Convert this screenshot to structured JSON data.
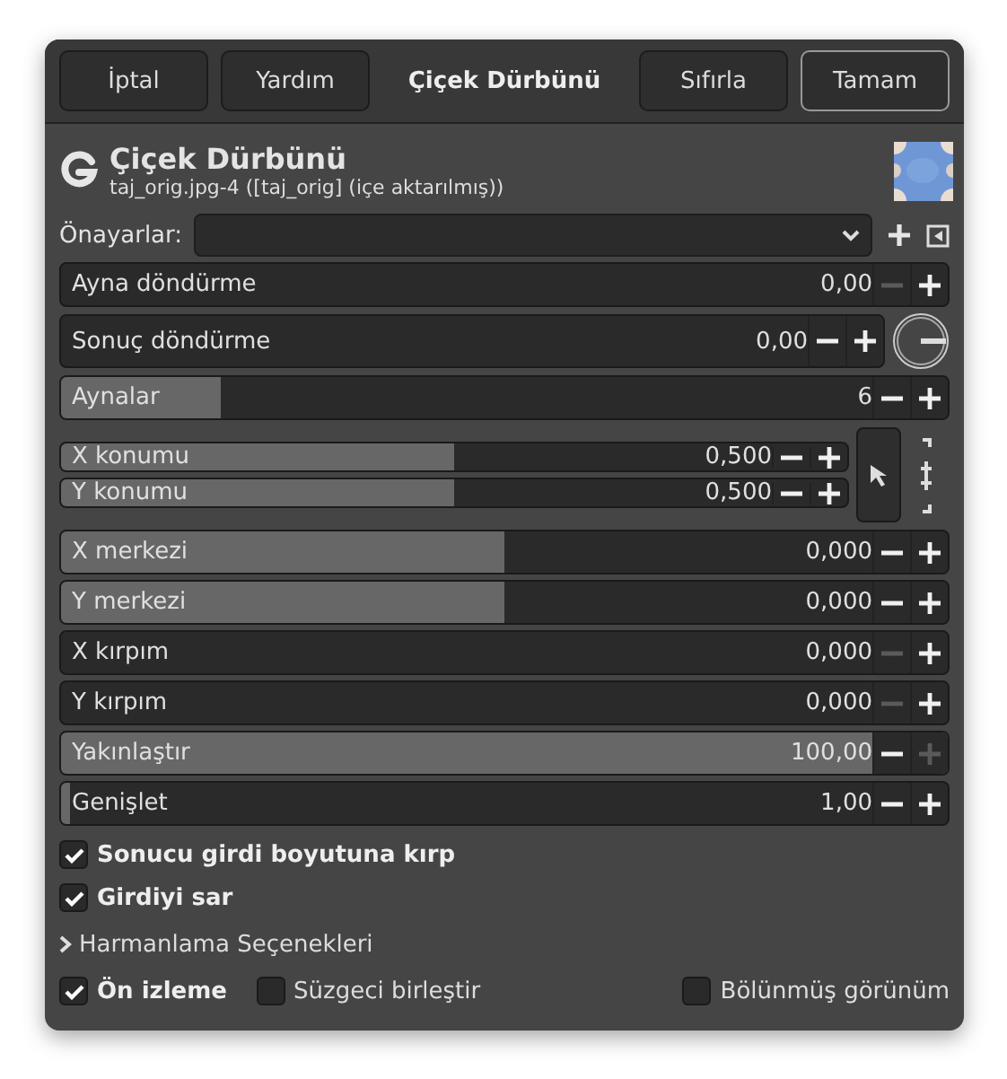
{
  "buttons": [
    {
      "label": "İptal",
      "default": false
    },
    {
      "label": "Yardım",
      "default": false
    }
  ],
  "dialog_title": "Çiçek Dürbünü",
  "buttons_right": [
    {
      "label": "Sıfırla",
      "default": false
    },
    {
      "label": "Tamam",
      "default": true
    }
  ],
  "header": {
    "title": "Çiçek Dürbünü",
    "subtitle": "taj_orig.jpg-4 ([taj_orig] (içe aktarılmış))"
  },
  "presets": {
    "label": "Önayarlar:"
  },
  "rows": [
    {
      "kind": "slider",
      "name": "Ayna döndürme",
      "value": "0,00",
      "level": 0,
      "minus_disabled": true,
      "plus_disabled": false
    },
    {
      "kind": "dial",
      "name": "Sonuç döndürme",
      "value": "0,00",
      "level": 0,
      "minus_disabled": false,
      "plus_disabled": false
    },
    {
      "kind": "slider",
      "name": "Aynalar",
      "value": "6",
      "level": 0.18,
      "minus_disabled": false,
      "plus_disabled": false
    },
    {
      "kind": "pair",
      "sliders": [
        {
          "name": "X konumu",
          "value": "0,500",
          "level": 0.5,
          "minus_disabled": false,
          "plus_disabled": false
        },
        {
          "name": "Y konumu",
          "value": "0,500",
          "level": 0.5,
          "minus_disabled": false,
          "plus_disabled": false
        }
      ]
    },
    {
      "kind": "slider",
      "name": "X merkezi",
      "value": "0,000",
      "level": 0.5,
      "minus_disabled": false,
      "plus_disabled": false
    },
    {
      "kind": "slider",
      "name": "Y merkezi",
      "value": "0,000",
      "level": 0.5,
      "minus_disabled": false,
      "plus_disabled": false
    },
    {
      "kind": "slider",
      "name": "X kırpım",
      "value": "0,000",
      "level": 0,
      "minus_disabled": true,
      "plus_disabled": false
    },
    {
      "kind": "slider",
      "name": "Y kırpım",
      "value": "0,000",
      "level": 0,
      "minus_disabled": true,
      "plus_disabled": false
    },
    {
      "kind": "slider",
      "name": "Yakınlaştır",
      "value": "100,00",
      "level": 1,
      "minus_disabled": false,
      "plus_disabled": true
    },
    {
      "kind": "slider",
      "name": "Genişlet",
      "value": "1,00",
      "level": 0.01,
      "minus_disabled": false,
      "plus_disabled": false
    }
  ],
  "options": [
    {
      "label": "Sonucu girdi boyutuna kırp",
      "checked": true
    },
    {
      "label": "Girdiyi sar",
      "checked": true
    }
  ],
  "expander": {
    "label": "Harmanlama Seçenekleri",
    "expanded": false
  },
  "footer": [
    {
      "label": "Ön izleme",
      "checked": true
    },
    {
      "label": "Süzgeci birleştir",
      "checked": false
    },
    {
      "label": "Bölünmüş görünüm",
      "checked": false
    }
  ]
}
